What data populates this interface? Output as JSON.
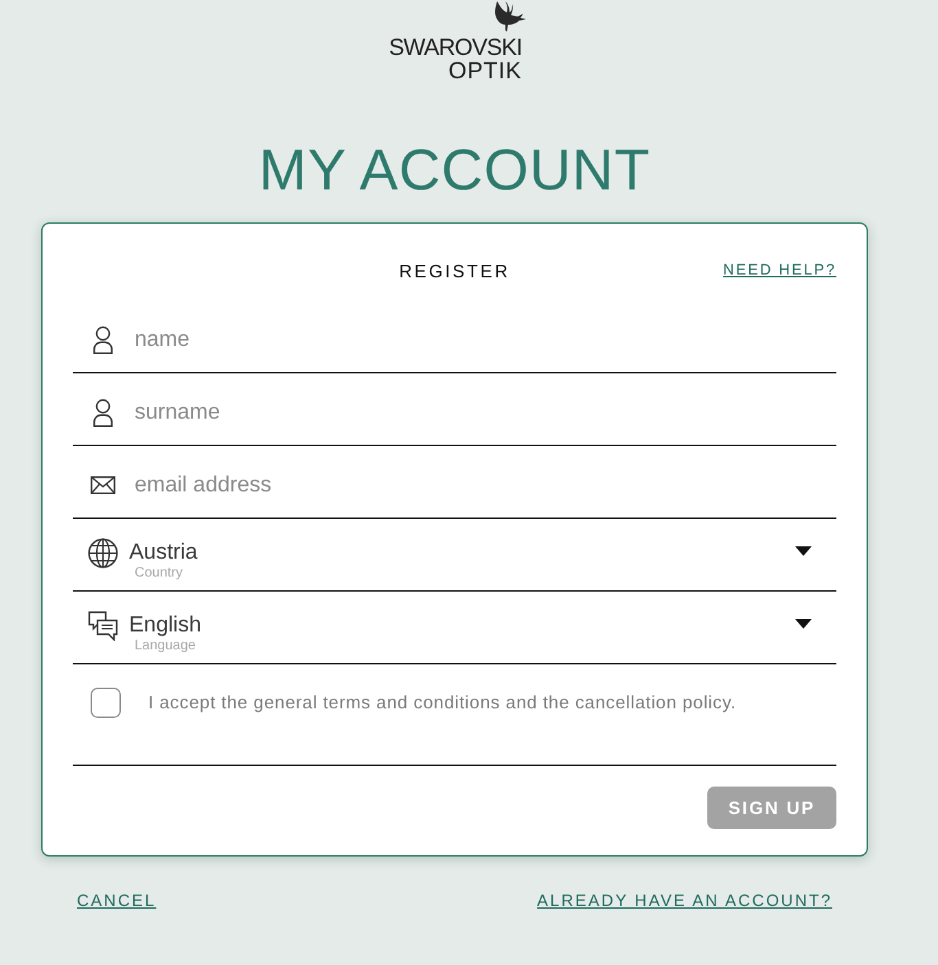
{
  "logo": {
    "line_1": "SWAROVSKI",
    "line_2": "OPTIK"
  },
  "page_title": "MY ACCOUNT",
  "card": {
    "title": "REGISTER",
    "help_link": "NEED HELP?"
  },
  "fields": [
    {
      "kind": "text",
      "placeholder": "name"
    },
    {
      "kind": "text",
      "placeholder": "surname"
    },
    {
      "kind": "email",
      "placeholder": "email address"
    },
    {
      "kind": "country",
      "value": "Austria",
      "label": "Country"
    },
    {
      "kind": "language",
      "value": "English",
      "label": "Language"
    }
  ],
  "terms": {
    "checked": false,
    "text": "I accept the general terms and conditions and the cancellation policy."
  },
  "submit": {
    "label": "SIGN UP",
    "disabled": true
  },
  "footer_links": [
    "CANCEL",
    "ALREADY HAVE AN ACCOUNT?"
  ]
}
